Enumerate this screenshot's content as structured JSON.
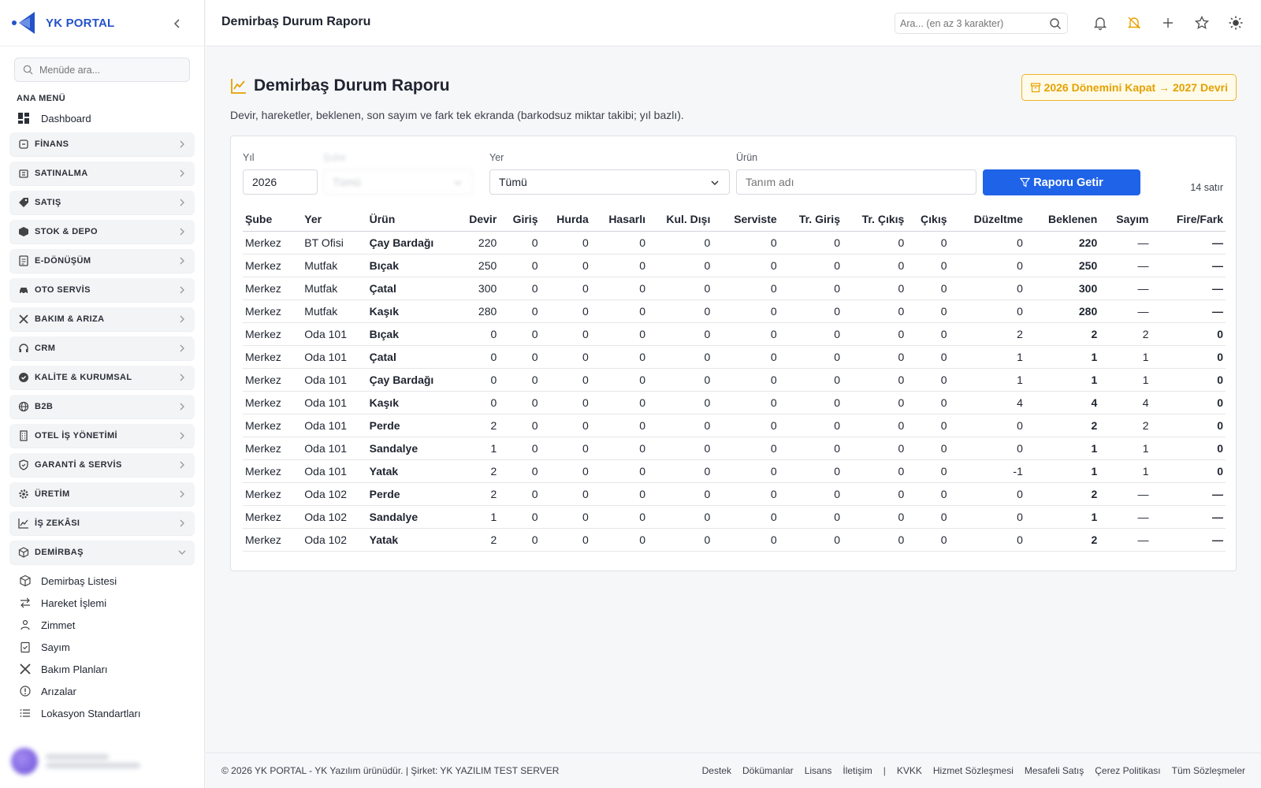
{
  "brand": {
    "name": "YK PORTAL"
  },
  "sidebar": {
    "search_placeholder": "Menüde ara...",
    "section_title": "ANA MENÜ",
    "dashboard_label": "Dashboard",
    "menu": [
      {
        "label": "FİNANS",
        "icon": "finance-icon"
      },
      {
        "label": "SATINALMA",
        "icon": "basket-icon"
      },
      {
        "label": "SATIŞ",
        "icon": "tag-icon"
      },
      {
        "label": "STOK & DEPO",
        "icon": "box-icon"
      },
      {
        "label": "E-DÖNÜŞÜM",
        "icon": "document-icon"
      },
      {
        "label": "OTO SERVİS",
        "icon": "car-icon"
      },
      {
        "label": "BAKIM & ARIZA",
        "icon": "tools-icon"
      },
      {
        "label": "CRM",
        "icon": "headset-icon"
      },
      {
        "label": "KALİTE & KURUMSAL",
        "icon": "badge-check-icon"
      },
      {
        "label": "B2B",
        "icon": "globe-icon"
      },
      {
        "label": "OTEL İŞ YÖNETİMİ",
        "icon": "building-icon"
      },
      {
        "label": "GARANTİ & SERVİS",
        "icon": "shield-icon"
      },
      {
        "label": "ÜRETİM",
        "icon": "gear-icon"
      },
      {
        "label": "İŞ ZEKÂSI",
        "icon": "chart-line-icon"
      },
      {
        "label": "DEMİRBAŞ",
        "icon": "cube-icon"
      }
    ],
    "sub_items": [
      {
        "label": "Demirbaş Listesi",
        "icon": "cube-icon"
      },
      {
        "label": "Hareket İşlemi",
        "icon": "swap-icon"
      },
      {
        "label": "Zimmet",
        "icon": "user-assign-icon"
      },
      {
        "label": "Sayım",
        "icon": "clipboard-check-icon"
      },
      {
        "label": "Bakım Planları",
        "icon": "tools-icon"
      },
      {
        "label": "Arızalar",
        "icon": "alert-circle-icon"
      },
      {
        "label": "Lokasyon Standartları",
        "icon": "list-icon"
      }
    ]
  },
  "header": {
    "title": "Demirbaş Durum Raporu",
    "search_placeholder": "Ara... (en az 3 karakter)",
    "accent": "#f0b429"
  },
  "page": {
    "title": "Demirbaş Durum Raporu",
    "subtitle": "Devir, hareketler, beklenen, son sayım ve fark tek ekranda (barkodsuz miktar takibi; yıl bazlı).",
    "close_button": "2026 Dönemini Kapat → 2027 Devri"
  },
  "filters": {
    "year_label": "Yıl",
    "year_value": "2026",
    "hidden_label": "Şube",
    "hidden_value": "Tümü",
    "place_label": "Yer",
    "place_value": "Tümü",
    "product_label": "Ürün",
    "product_placeholder": "Tanım adı",
    "run_button": "Raporu Getir",
    "row_count": "14 satır",
    "primary_color": "#1f63e8"
  },
  "table": {
    "headers": [
      "Şube",
      "Yer",
      "Ürün",
      "Devir",
      "Giriş",
      "Hurda",
      "Hasarlı",
      "Kul. Dışı",
      "Serviste",
      "Tr. Giriş",
      "Tr. Çıkış",
      "Çıkış",
      "Düzeltme",
      "Beklenen",
      "Sayım",
      "Fire/Fark"
    ],
    "rows": [
      [
        "Merkez",
        "BT Ofisi",
        "Çay Bardağı",
        "220",
        "0",
        "0",
        "0",
        "0",
        "0",
        "0",
        "0",
        "0",
        "0",
        "220",
        "—",
        "—"
      ],
      [
        "Merkez",
        "Mutfak",
        "Bıçak",
        "250",
        "0",
        "0",
        "0",
        "0",
        "0",
        "0",
        "0",
        "0",
        "0",
        "250",
        "—",
        "—"
      ],
      [
        "Merkez",
        "Mutfak",
        "Çatal",
        "300",
        "0",
        "0",
        "0",
        "0",
        "0",
        "0",
        "0",
        "0",
        "0",
        "300",
        "—",
        "—"
      ],
      [
        "Merkez",
        "Mutfak",
        "Kaşık",
        "280",
        "0",
        "0",
        "0",
        "0",
        "0",
        "0",
        "0",
        "0",
        "0",
        "280",
        "—",
        "—"
      ],
      [
        "Merkez",
        "Oda 101",
        "Bıçak",
        "0",
        "0",
        "0",
        "0",
        "0",
        "0",
        "0",
        "0",
        "0",
        "2",
        "2",
        "2",
        "0"
      ],
      [
        "Merkez",
        "Oda 101",
        "Çatal",
        "0",
        "0",
        "0",
        "0",
        "0",
        "0",
        "0",
        "0",
        "0",
        "1",
        "1",
        "1",
        "0"
      ],
      [
        "Merkez",
        "Oda 101",
        "Çay Bardağı",
        "0",
        "0",
        "0",
        "0",
        "0",
        "0",
        "0",
        "0",
        "0",
        "1",
        "1",
        "1",
        "0"
      ],
      [
        "Merkez",
        "Oda 101",
        "Kaşık",
        "0",
        "0",
        "0",
        "0",
        "0",
        "0",
        "0",
        "0",
        "0",
        "4",
        "4",
        "4",
        "0"
      ],
      [
        "Merkez",
        "Oda 101",
        "Perde",
        "2",
        "0",
        "0",
        "0",
        "0",
        "0",
        "0",
        "0",
        "0",
        "0",
        "2",
        "2",
        "0"
      ],
      [
        "Merkez",
        "Oda 101",
        "Sandalye",
        "1",
        "0",
        "0",
        "0",
        "0",
        "0",
        "0",
        "0",
        "0",
        "0",
        "1",
        "1",
        "0"
      ],
      [
        "Merkez",
        "Oda 101",
        "Yatak",
        "2",
        "0",
        "0",
        "0",
        "0",
        "0",
        "0",
        "0",
        "0",
        "-1",
        "1",
        "1",
        "0"
      ],
      [
        "Merkez",
        "Oda 102",
        "Perde",
        "2",
        "0",
        "0",
        "0",
        "0",
        "0",
        "0",
        "0",
        "0",
        "0",
        "2",
        "—",
        "—"
      ],
      [
        "Merkez",
        "Oda 102",
        "Sandalye",
        "1",
        "0",
        "0",
        "0",
        "0",
        "0",
        "0",
        "0",
        "0",
        "0",
        "1",
        "—",
        "—"
      ],
      [
        "Merkez",
        "Oda 102",
        "Yatak",
        "2",
        "0",
        "0",
        "0",
        "0",
        "0",
        "0",
        "0",
        "0",
        "0",
        "2",
        "—",
        "—"
      ]
    ]
  },
  "footer": {
    "copyright": "© 2026 YK PORTAL - YK Yazılım ürünüdür. | Şirket: YK YAZILIM TEST SERVER",
    "links": [
      "Destek",
      "Dökümanlar",
      "Lisans",
      "İletişim",
      "|",
      "KVKK",
      "Hizmet Sözleşmesi",
      "Mesafeli Satış",
      "Çerez Politikası",
      "Tüm Sözleşmeler"
    ]
  }
}
